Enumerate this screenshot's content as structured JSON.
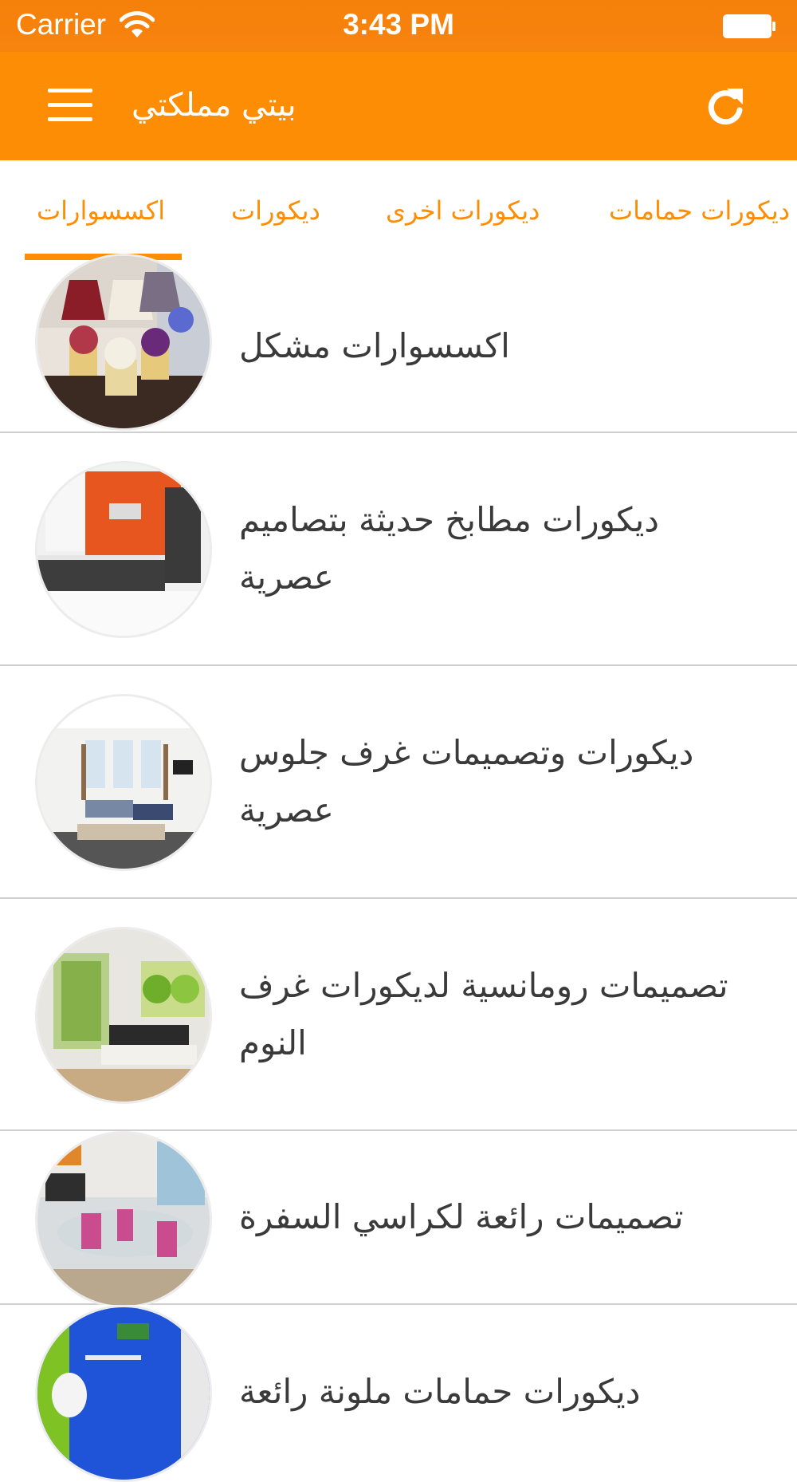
{
  "status_bar": {
    "carrier": "Carrier",
    "time": "3:43 PM"
  },
  "nav": {
    "title": "بيتي مملكتي",
    "menu_icon": "hamburger-icon",
    "refresh_icon": "refresh-icon"
  },
  "tabs": {
    "items": [
      {
        "label": "اكسسوارات",
        "selected": true
      },
      {
        "label": "ديكورات",
        "selected": false
      },
      {
        "label": "ديكورات اخرى",
        "selected": false
      },
      {
        "label": "ديكورات حمامات",
        "selected": false
      }
    ],
    "accent": "#fd8d05"
  },
  "list": {
    "items": [
      {
        "title": "اكسسوارات مشكل"
      },
      {
        "title": "ديكورات مطابخ حديثة بتصاميم عصرية"
      },
      {
        "title": "ديكورات وتصميمات غرف جلوس عصرية"
      },
      {
        "title": "تصميمات رومانسية لديكورات غرف النوم"
      },
      {
        "title": "تصميمات رائعة لكراسي السفرة"
      },
      {
        "title": "ديكورات حمامات ملونة رائعة"
      }
    ]
  },
  "colors": {
    "status_bar": "#f5800a",
    "nav_bar": "#fd8d05",
    "text": "#3a3a3a",
    "divider": "#cfcfcf"
  }
}
